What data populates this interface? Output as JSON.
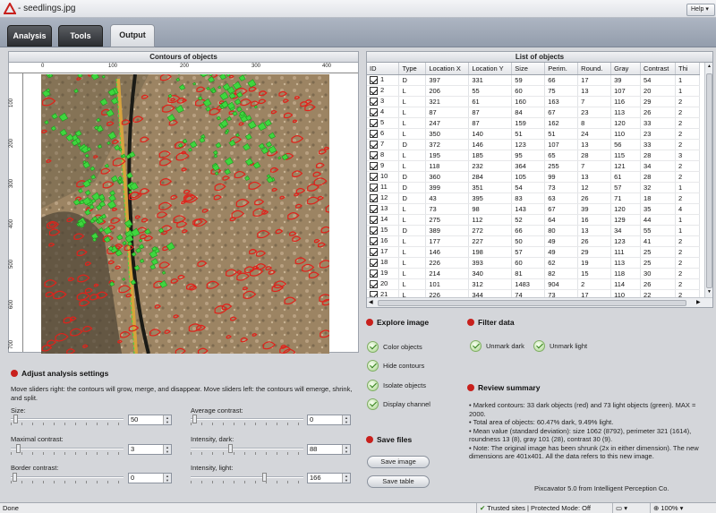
{
  "window": {
    "title": "- seedlings.jpg",
    "help_label": "Help"
  },
  "tabs": [
    {
      "label": "Analysis"
    },
    {
      "label": "Tools"
    },
    {
      "label": "Output"
    }
  ],
  "contours": {
    "title": "Contours of objects",
    "ruler_top": [
      "0",
      "100",
      "200",
      "300",
      "400"
    ],
    "ruler_left": [
      "100",
      "200",
      "300",
      "400",
      "500",
      "600",
      "700"
    ]
  },
  "list": {
    "title": "List of objects",
    "columns": [
      "ID",
      "Type",
      "Location X",
      "Location Y",
      "Size",
      "Perim.",
      "Round.",
      "Gray",
      "Contrast",
      "Thi"
    ],
    "rows": [
      [
        "1",
        "D",
        "397",
        "331",
        "59",
        "66",
        "17",
        "39",
        "54",
        "1"
      ],
      [
        "2",
        "L",
        "206",
        "55",
        "60",
        "75",
        "13",
        "107",
        "20",
        "1"
      ],
      [
        "3",
        "L",
        "321",
        "61",
        "160",
        "163",
        "7",
        "116",
        "29",
        "2"
      ],
      [
        "4",
        "L",
        "87",
        "87",
        "84",
        "67",
        "23",
        "113",
        "26",
        "2"
      ],
      [
        "5",
        "L",
        "247",
        "87",
        "159",
        "162",
        "8",
        "120",
        "33",
        "2"
      ],
      [
        "6",
        "L",
        "350",
        "140",
        "51",
        "51",
        "24",
        "110",
        "23",
        "2"
      ],
      [
        "7",
        "D",
        "372",
        "146",
        "123",
        "107",
        "13",
        "56",
        "33",
        "2"
      ],
      [
        "8",
        "L",
        "195",
        "185",
        "95",
        "65",
        "28",
        "115",
        "28",
        "3"
      ],
      [
        "9",
        "L",
        "118",
        "232",
        "364",
        "255",
        "7",
        "121",
        "34",
        "2"
      ],
      [
        "10",
        "D",
        "360",
        "284",
        "105",
        "99",
        "13",
        "61",
        "28",
        "2"
      ],
      [
        "11",
        "D",
        "399",
        "351",
        "54",
        "73",
        "12",
        "57",
        "32",
        "1"
      ],
      [
        "12",
        "D",
        "43",
        "395",
        "83",
        "63",
        "26",
        "71",
        "18",
        "2"
      ],
      [
        "13",
        "L",
        "73",
        "98",
        "143",
        "67",
        "39",
        "120",
        "35",
        "4"
      ],
      [
        "14",
        "L",
        "275",
        "112",
        "52",
        "64",
        "16",
        "129",
        "44",
        "1"
      ],
      [
        "15",
        "D",
        "389",
        "272",
        "66",
        "80",
        "13",
        "34",
        "55",
        "1"
      ],
      [
        "16",
        "L",
        "177",
        "227",
        "50",
        "49",
        "26",
        "123",
        "41",
        "2"
      ],
      [
        "17",
        "L",
        "146",
        "198",
        "57",
        "49",
        "29",
        "111",
        "25",
        "2"
      ],
      [
        "18",
        "L",
        "226",
        "393",
        "60",
        "62",
        "19",
        "113",
        "25",
        "2"
      ],
      [
        "19",
        "L",
        "214",
        "340",
        "81",
        "82",
        "15",
        "118",
        "30",
        "2"
      ],
      [
        "20",
        "L",
        "101",
        "312",
        "1483",
        "904",
        "2",
        "114",
        "26",
        "2"
      ],
      [
        "21",
        "L",
        "226",
        "344",
        "74",
        "73",
        "17",
        "110",
        "22",
        "2"
      ]
    ]
  },
  "adjust": {
    "title": "Adjust analysis settings",
    "description": "Move sliders right: the contours will grow, merge, and disappear. Move sliders left: the contours will emerge, shrink, and split.",
    "size_label": "Size:",
    "size_value": "50",
    "avg_contrast_label": "Average contrast:",
    "avg_contrast_value": "0",
    "max_contrast_label": "Maximal contrast:",
    "max_contrast_value": "3",
    "int_dark_label": "Intensity, dark:",
    "int_dark_value": "88",
    "border_contrast_label": "Border contrast:",
    "border_contrast_value": "0",
    "int_light_label": "Intensity, light:",
    "int_light_value": "166"
  },
  "explore": {
    "title": "Explore image",
    "items": [
      "Color objects",
      "Hide contours",
      "Isolate objects",
      "Display channel"
    ]
  },
  "filter": {
    "title": "Filter data",
    "unmark_dark": "Unmark dark",
    "unmark_light": "Unmark light"
  },
  "save": {
    "title": "Save files",
    "save_image": "Save image",
    "save_table": "Save table"
  },
  "review": {
    "title": "Review summary",
    "lines": [
      "• Marked contours: 33 dark objects (red) and 73 light objects (green). MAX = 2000.",
      "• Total area of objects: 60.47% dark, 9.49% light.",
      "• Mean value (standard deviation): size 1062 (8792), perimeter 321 (1614), roundness 13 (8), gray 101 (28), contrast 30 (9).",
      "• Note: The original image has been shrunk (2x in either dimension). The new dimensions are 401x401. All the data refers to this new image."
    ],
    "powered": "Pixcavator 5.0 from Intelligent Perception Co."
  },
  "status": {
    "left": "Done",
    "zone": "Trusted sites | Protected Mode: Off",
    "zoom": "100%"
  },
  "colors": {
    "accent": "#c8201c",
    "dark_contour": "#e0221b",
    "light_contour": "#3fd63f"
  }
}
